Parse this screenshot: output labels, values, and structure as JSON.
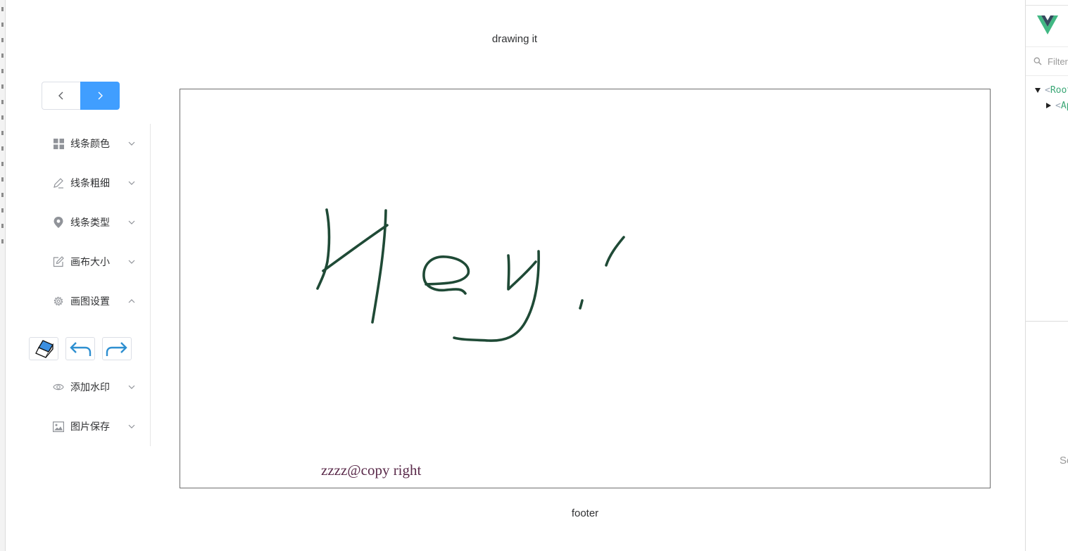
{
  "app": {
    "title": "drawing it",
    "footer": "footer"
  },
  "pager": {
    "prev_icon": "chevron-left-icon",
    "next_icon": "chevron-right-icon",
    "active_color": "#409eff"
  },
  "menu": {
    "items": [
      {
        "label": "线条颜色",
        "icon": "grid-icon",
        "expanded": false
      },
      {
        "label": "线条粗细",
        "icon": "pencil-icon",
        "expanded": false
      },
      {
        "label": "线条类型",
        "icon": "location-icon",
        "expanded": false
      },
      {
        "label": "画布大小",
        "icon": "edit-icon",
        "expanded": false
      },
      {
        "label": "画图设置",
        "icon": "gear-icon",
        "expanded": true
      },
      {
        "label": "添加水印",
        "icon": "eye-icon",
        "expanded": false
      },
      {
        "label": "图片保存",
        "icon": "picture-icon",
        "expanded": false
      }
    ],
    "tools": [
      "eraser-icon",
      "undo-icon",
      "redo-icon"
    ]
  },
  "canvas": {
    "watermark": "zzzz@copy right",
    "stroke_color": "#1f4a36",
    "drawn_text": "Hey!"
  },
  "devtools": {
    "filter_placeholder": "Filter",
    "tree": [
      {
        "tag": "Root",
        "expanded": true
      },
      {
        "tag": "App",
        "expanded": false
      }
    ],
    "side_text": "Se",
    "logo_color": "#41b883"
  }
}
